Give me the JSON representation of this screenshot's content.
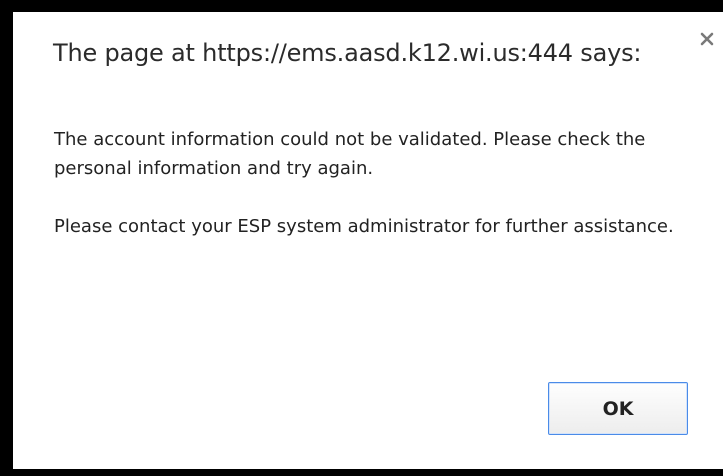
{
  "dialog": {
    "title": "The page at https://ems.aasd.k12.wi.us:444 says:",
    "close_icon": "close-icon",
    "message_paragraphs": [
      "The account information could not be validated. Please check the personal information and try again.",
      "Please contact your ESP system administrator for further assistance."
    ],
    "ok_label": "OK"
  },
  "colors": {
    "frame": "#000000",
    "dialog_background": "#ffffff",
    "button_border": "#4a8be8"
  }
}
